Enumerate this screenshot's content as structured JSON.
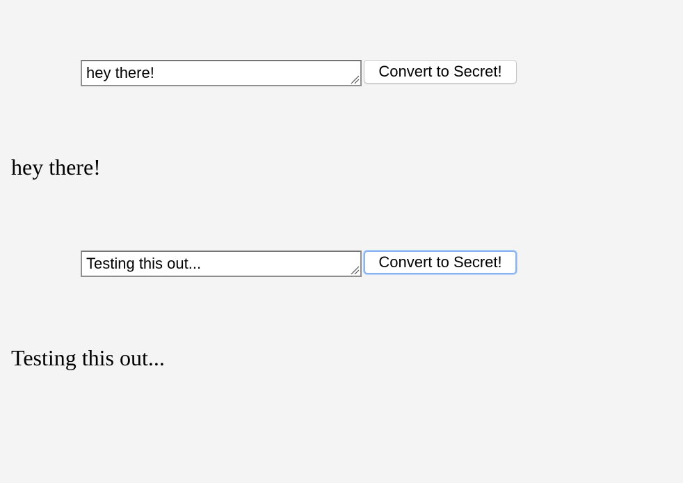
{
  "entries": [
    {
      "input_value": "hey there!",
      "button_label": "Convert to Secret!",
      "output_text": "hey there!"
    },
    {
      "input_value": "Testing this out...",
      "button_label": "Convert to Secret!",
      "output_text": "Testing this out..."
    }
  ],
  "colors": {
    "background": "#f4f4f4",
    "focus_ring": "#8ab4ef"
  }
}
